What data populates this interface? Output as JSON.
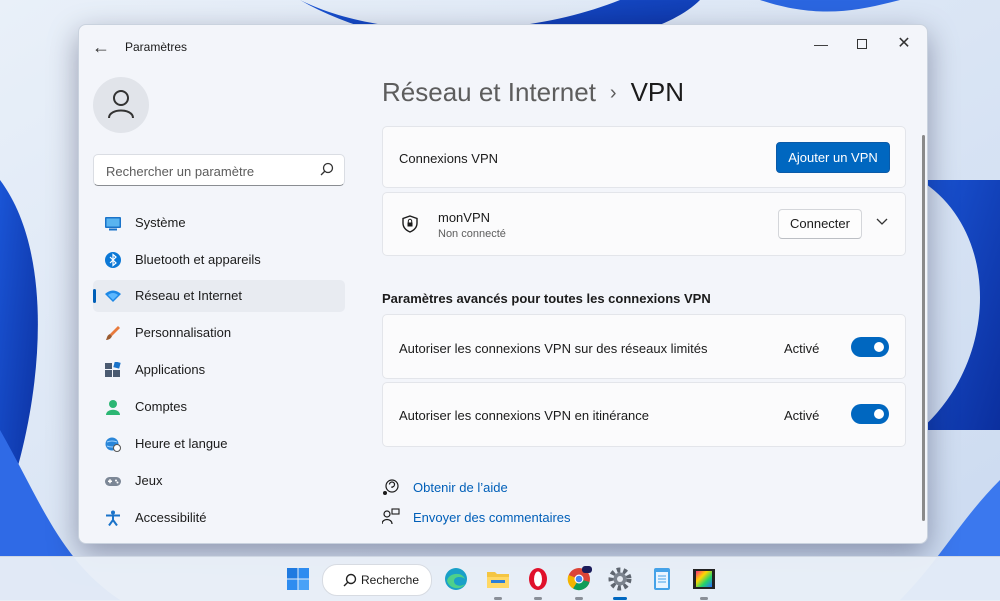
{
  "window": {
    "title": "Paramètres"
  },
  "sidebar": {
    "search_placeholder": "Rechercher un paramètre",
    "items": [
      {
        "label": "Système",
        "icon": "system-icon"
      },
      {
        "label": "Bluetooth et appareils",
        "icon": "bluetooth-icon"
      },
      {
        "label": "Réseau et Internet",
        "icon": "wifi-icon",
        "active": true
      },
      {
        "label": "Personnalisation",
        "icon": "brush-icon"
      },
      {
        "label": "Applications",
        "icon": "apps-icon"
      },
      {
        "label": "Comptes",
        "icon": "account-icon"
      },
      {
        "label": "Heure et langue",
        "icon": "globe-clock-icon"
      },
      {
        "label": "Jeux",
        "icon": "gamepad-icon"
      },
      {
        "label": "Accessibilité",
        "icon": "accessibility-icon"
      }
    ]
  },
  "breadcrumb": {
    "parent": "Réseau et Internet",
    "separator": "›",
    "current": "VPN"
  },
  "vpn_connections": {
    "label": "Connexions VPN",
    "add_button": "Ajouter un VPN"
  },
  "vpn_entry": {
    "name": "monVPN",
    "status": "Non connecté",
    "connect_button": "Connecter"
  },
  "advanced": {
    "title": "Paramètres avancés pour toutes les connexions VPN",
    "settings": [
      {
        "label": "Autoriser les connexions VPN sur des réseaux limités",
        "state": "Activé",
        "on": true
      },
      {
        "label": "Autoriser les connexions VPN en itinérance",
        "state": "Activé",
        "on": true
      }
    ]
  },
  "help": {
    "get_help": "Obtenir de l’aide",
    "feedback": "Envoyer des commentaires"
  },
  "taskbar": {
    "search_label": "Recherche",
    "apps": [
      "start-icon",
      "edge-icon",
      "file-explorer-icon",
      "opera-icon",
      "chrome-icon",
      "settings-icon",
      "notepad-icon",
      "photos-icon"
    ]
  },
  "colors": {
    "accent": "#0067c0",
    "link": "#005fb8"
  }
}
